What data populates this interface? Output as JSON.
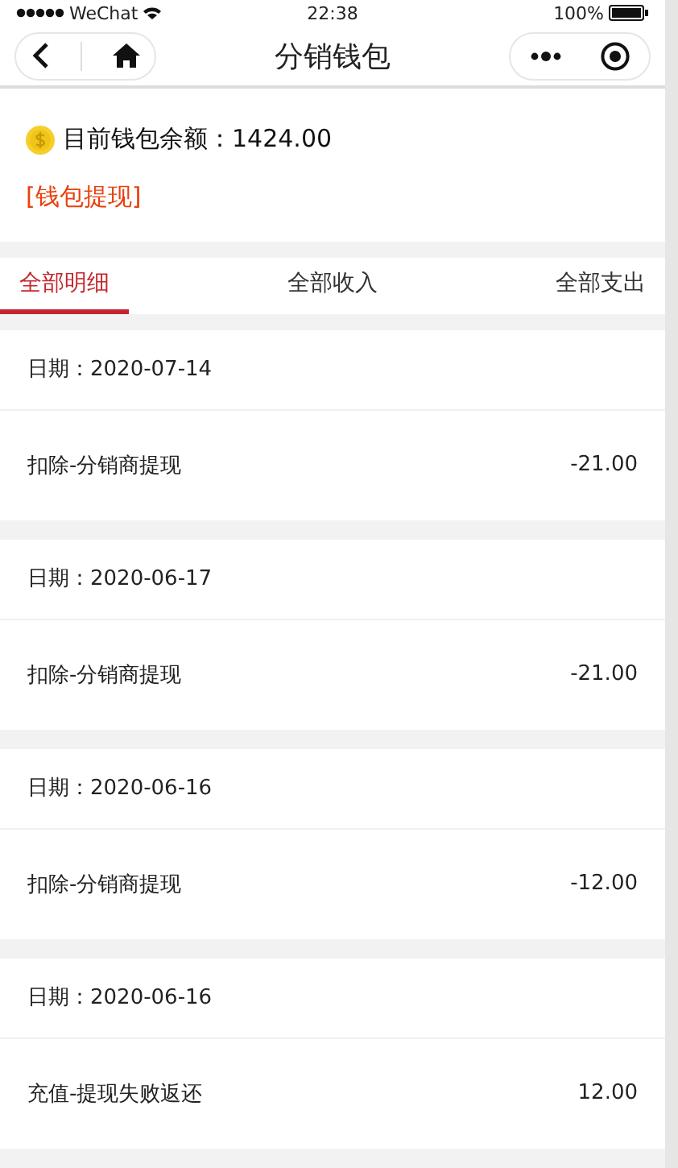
{
  "status_bar": {
    "carrier": "WeChat",
    "time": "22:38",
    "battery": "100%"
  },
  "nav": {
    "title": "分销钱包"
  },
  "balance": {
    "label": "目前钱包余额：1424.00",
    "withdraw_link": "[钱包提现]"
  },
  "tabs": [
    {
      "label": "全部明细",
      "selected": true
    },
    {
      "label": "全部收入",
      "selected": false
    },
    {
      "label": "全部支出",
      "selected": false
    }
  ],
  "records": [
    {
      "date": "日期：2020-07-14",
      "description": "扣除-分销商提现",
      "amount": "-21.00"
    },
    {
      "date": "日期：2020-06-17",
      "description": "扣除-分销商提现",
      "amount": "-21.00"
    },
    {
      "date": "日期：2020-06-16",
      "description": "扣除-分销商提现",
      "amount": "-12.00"
    },
    {
      "date": "日期：2020-06-16",
      "description": "充值-提现失败返还",
      "amount": "12.00"
    }
  ]
}
